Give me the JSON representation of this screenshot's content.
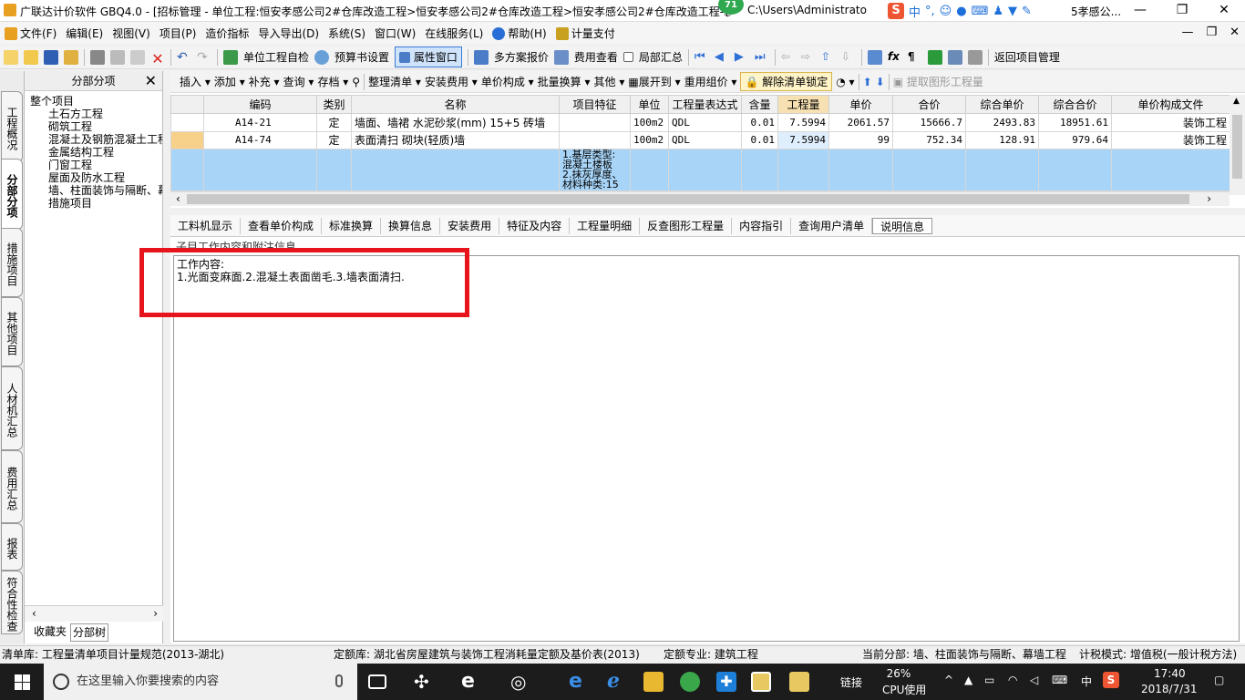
{
  "window": {
    "title": "广联达计价软件 GBQ4.0 - [招标管理 - 单位工程:恒安孝感公司2#仓库改造工程>恒安孝感公司2#仓库改造工程>恒安孝感公司2#仓库改造工程-装饰部分",
    "path": "C:\\Users\\Administrato",
    "title_tail": "5孝感公...",
    "badge": "71"
  },
  "ime": {
    "lang": "中",
    "punct": "°,"
  },
  "menu": [
    "文件(F)",
    "编辑(E)",
    "视图(V)",
    "项目(P)",
    "造价指标",
    "导入导出(D)",
    "系统(S)",
    "窗口(W)",
    "在线服务(L)",
    "帮助(H)",
    "计量支付"
  ],
  "toolbar1": {
    "self_check": "单位工程自检",
    "budget_settings": "预算书设置",
    "property_window": "属性窗口",
    "multi_quote": "多方案报价",
    "fee_view": "费用查看",
    "partial_summary": "局部汇总",
    "return_project": "返回项目管理"
  },
  "toolbar2": [
    "插入",
    "添加",
    "补充",
    "查询",
    "存档",
    "整理清单",
    "安装费用",
    "单价构成",
    "批量换算",
    "其他",
    "展开到",
    "重用组价"
  ],
  "toolbar2_lock": "解除清单锁定",
  "toolbar2_extract": "提取图形工程量",
  "left_tabs": [
    "工程概况",
    "分部分项",
    "措施项目",
    "其他项目",
    "人材机汇总",
    "费用汇总",
    "报表",
    "符合性检查"
  ],
  "tree": {
    "header": "分部分项",
    "root": "整个项目",
    "children": [
      "土石方工程",
      "砌筑工程",
      "混凝土及钢筋混凝土工程",
      "金属结构工程",
      "门窗工程",
      "屋面及防水工程",
      "墙、柱面装饰与隔断、幕墙工程",
      "措施项目"
    ],
    "tabs": [
      "收藏夹",
      "分部树"
    ]
  },
  "grid": {
    "columns": [
      "编码",
      "类别",
      "名称",
      "项目特征",
      "单位",
      "工程量表达式",
      "含量",
      "工程量",
      "单价",
      "合价",
      "综合单价",
      "综合合价",
      "单价构成文件"
    ],
    "rows": [
      {
        "code": "A14-21",
        "type": "定",
        "name": "墙面、墙裙 水泥砂浆(mm) 15+5 砖墙",
        "feature": "",
        "unit": "100m2",
        "expr": "QDL",
        "content": "0.01",
        "qty": "7.5994",
        "price": "2061.57",
        "total": "15666.7",
        "unit_price": "2493.83",
        "sum_total": "18951.61",
        "file": "装饰工程"
      },
      {
        "code": "A14-74",
        "type": "定",
        "name": "表面清扫 砌块(轻质)墙",
        "feature": "",
        "unit": "100m2",
        "expr": "QDL",
        "content": "0.01",
        "qty": "7.5994",
        "price": "99",
        "total": "752.34",
        "unit_price": "128.91",
        "sum_total": "979.64",
        "file": "装饰工程"
      }
    ],
    "feature_lines": [
      "1.基层类型:",
      "混凝土楼板",
      "2.抹灰厚度、",
      "材料种类:15"
    ]
  },
  "bottom_tabs": [
    "工料机显示",
    "查看单价构成",
    "标准换算",
    "换算信息",
    "安装费用",
    "特征及内容",
    "工程量明细",
    "反查图形工程量",
    "内容指引",
    "查询用户清单",
    "说明信息"
  ],
  "info": {
    "subheader": "子目工作内容和附注信息",
    "label": "工作内容:",
    "text": "1.光面变麻面.2.混凝土表面凿毛.3.墙表面清扫."
  },
  "status": {
    "list_lib": "清单库: 工程量清单项目计量规范(2013-湖北)",
    "quota_lib": "定额库: 湖北省房屋建筑与装饰工程消耗量定额及基价表(2013)",
    "quota_major": "定额专业: 建筑工程",
    "current_part": "当前分部: 墙、柱面装饰与隔断、幕墙工程",
    "tax_mode": "计税模式: 增值税(一般计税方法)"
  },
  "taskbar": {
    "search_placeholder": "在这里输入你要搜索的内容",
    "link": "链接",
    "cpu_pct": "26%",
    "cpu_label": "CPU使用",
    "ime": "中",
    "time": "17:40",
    "date": "2018/7/31"
  },
  "colors": {
    "highlight_row": "#a8d4f7",
    "red_box": "#e8141c",
    "active_col": "#f7e1b3"
  }
}
